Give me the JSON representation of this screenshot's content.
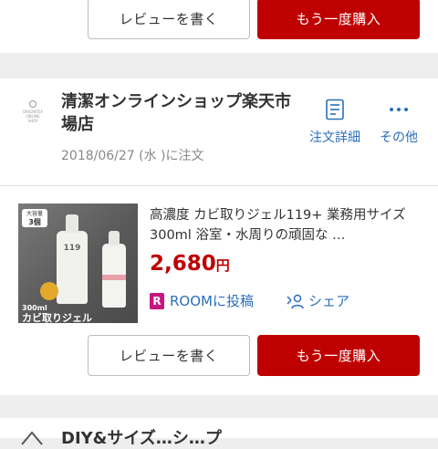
{
  "top_card": {
    "review_button": "レビューを書く",
    "buy_again_button": "もう一度購入"
  },
  "shop": {
    "logo_text": "ORIGINTEA ONLINE SHOP",
    "name": "清潔オンラインショップ楽天市場店",
    "order_date": "2018/06/27 (水 )に注文",
    "order_detail_label": "注文詳細",
    "more_label": "その他"
  },
  "product": {
    "title": "高濃度 カビ取りジェル119+ 業務用サイズ300ml 浴室・水周りの頑固な …",
    "price_number": "2,680",
    "price_unit": "円",
    "room_label": "ROOMに投稿",
    "share_label": "シェア",
    "image_badge_top": "大容量",
    "image_badge_count": "3個",
    "image_caption_small": "300ml",
    "image_caption": "カビ取りジェル",
    "bottle_label": "119"
  },
  "bottom_card": {
    "review_button": "レビューを書く",
    "buy_again_button": "もう一度購入"
  },
  "next_shop": {
    "name_partial": "DIY&サイズ…シ…プ"
  },
  "colors": {
    "accent_red": "#bf0000",
    "link_blue": "#2a6eba",
    "room_pink": "#c8167f"
  }
}
